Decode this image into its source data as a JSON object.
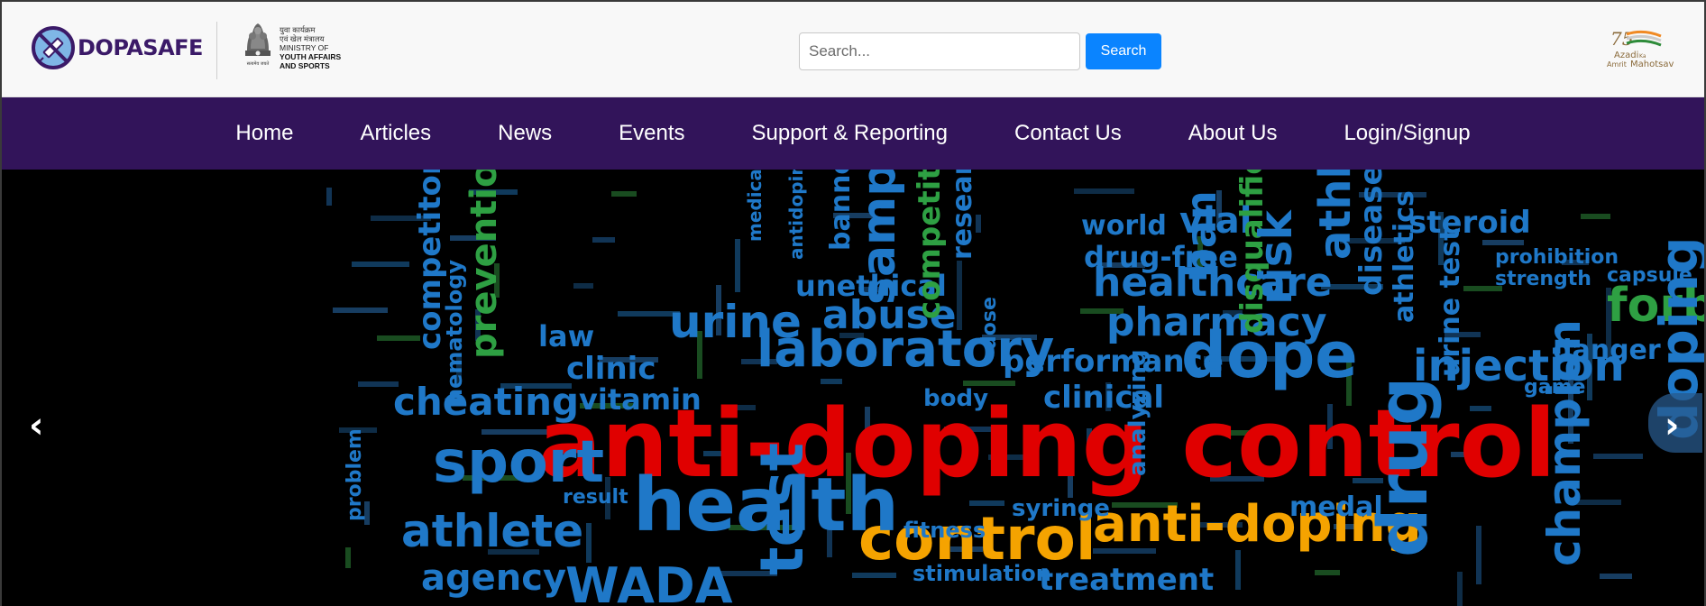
{
  "header": {
    "brand_name": "DOPASAFE",
    "ministry_hindi_line1": "युवा कार्यक्रम",
    "ministry_hindi_line2": "एवं खेल मंत्रालय",
    "ministry_en_line1": "MINISTRY OF",
    "ministry_en_line2": "YOUTH AFFAIRS",
    "ministry_en_line3": "AND SPORTS",
    "emblem_caption": "सत्यमेव जयते",
    "search_placeholder": "Search...",
    "search_button": "Search",
    "azadi_line1": "Azadi",
    "azadi_ka": "Ka",
    "azadi_line2": "Amrit",
    "azadi_line3": "Mahotsav",
    "azadi_number": "75"
  },
  "nav": {
    "items": [
      "Home",
      "Articles",
      "News",
      "Events",
      "Support & Reporting",
      "Contact Us",
      "About Us",
      "Login/Signup"
    ]
  },
  "hero": {
    "prev_arrow": "‹",
    "next_arrow": "›",
    "words": [
      {
        "text": "anti-doping control",
        "color": "#e00000"
      },
      {
        "text": "control",
        "color": "#f5a300"
      },
      {
        "text": "anti-doping",
        "color": "#f5a300"
      },
      {
        "text": "health",
        "color": "#1f78c8"
      },
      {
        "text": "sport",
        "color": "#1f78c8"
      },
      {
        "text": "laboratory",
        "color": "#1f78c8"
      },
      {
        "text": "dope",
        "color": "#1f78c8"
      },
      {
        "text": "injection",
        "color": "#1f78c8"
      },
      {
        "text": "urine",
        "color": "#1f78c8"
      },
      {
        "text": "abuse",
        "color": "#1f78c8"
      },
      {
        "text": "cheating",
        "color": "#1f78c8"
      },
      {
        "text": "athlete",
        "color": "#1f78c8"
      },
      {
        "text": "agency",
        "color": "#1f78c8"
      },
      {
        "text": "WADA",
        "color": "#1f78c8"
      },
      {
        "text": "healthcare",
        "color": "#1f78c8"
      },
      {
        "text": "pharmacy",
        "color": "#1f78c8"
      },
      {
        "text": "performance",
        "color": "#1f78c8"
      },
      {
        "text": "unethical",
        "color": "#1f78c8"
      },
      {
        "text": "world",
        "color": "#1f78c8"
      },
      {
        "text": "vial",
        "color": "#1f78c8"
      },
      {
        "text": "drug-free",
        "color": "#1f78c8"
      },
      {
        "text": "steroid",
        "color": "#1f78c8"
      },
      {
        "text": "prohibition",
        "color": "#1f78c8"
      },
      {
        "text": "strength",
        "color": "#1f78c8"
      },
      {
        "text": "capsule",
        "color": "#1f78c8"
      },
      {
        "text": "forbidden",
        "color": "#2ea043"
      },
      {
        "text": "danger",
        "color": "#1f78c8"
      },
      {
        "text": "clinic",
        "color": "#1f78c8"
      },
      {
        "text": "vitamin",
        "color": "#1f78c8"
      },
      {
        "text": "law",
        "color": "#1f78c8"
      },
      {
        "text": "clinical",
        "color": "#1f78c8"
      },
      {
        "text": "body",
        "color": "#1f78c8"
      },
      {
        "text": "medal",
        "color": "#1f78c8"
      },
      {
        "text": "syringe",
        "color": "#1f78c8"
      },
      {
        "text": "fitness",
        "color": "#1f78c8"
      },
      {
        "text": "treatment",
        "color": "#1f78c8"
      },
      {
        "text": "stimulation",
        "color": "#1f78c8"
      },
      {
        "text": "result",
        "color": "#1f78c8"
      },
      {
        "text": "game",
        "color": "#1f78c8"
      },
      {
        "text": "sample",
        "color": "#1f78c8"
      },
      {
        "text": "competitive",
        "color": "#2ea043"
      },
      {
        "text": "prevention",
        "color": "#2ea043"
      },
      {
        "text": "disqualification",
        "color": "#2ea043"
      },
      {
        "text": "risk",
        "color": "#1f78c8"
      },
      {
        "text": "athletic",
        "color": "#1f78c8"
      },
      {
        "text": "disease",
        "color": "#1f78c8"
      },
      {
        "text": "ban",
        "color": "#1f78c8"
      },
      {
        "text": "banned",
        "color": "#1f78c8"
      },
      {
        "text": "research",
        "color": "#1f78c8"
      },
      {
        "text": "competitor",
        "color": "#1f78c8"
      },
      {
        "text": "hematology",
        "color": "#1f78c8"
      },
      {
        "text": "medication",
        "color": "#1f78c8"
      },
      {
        "text": "antidoping",
        "color": "#1f78c8"
      },
      {
        "text": "athletics",
        "color": "#1f78c8"
      },
      {
        "text": "urine test",
        "color": "#1f78c8"
      },
      {
        "text": "champion",
        "color": "#1f78c8"
      },
      {
        "text": "doping",
        "color": "#1f78c8"
      },
      {
        "text": "drug",
        "color": "#1f78c8"
      },
      {
        "text": "test",
        "color": "#1f78c8"
      },
      {
        "text": "problem",
        "color": "#1f78c8"
      },
      {
        "text": "dose",
        "color": "#1f78c8"
      },
      {
        "text": "analyzing",
        "color": "#1f78c8"
      }
    ]
  }
}
